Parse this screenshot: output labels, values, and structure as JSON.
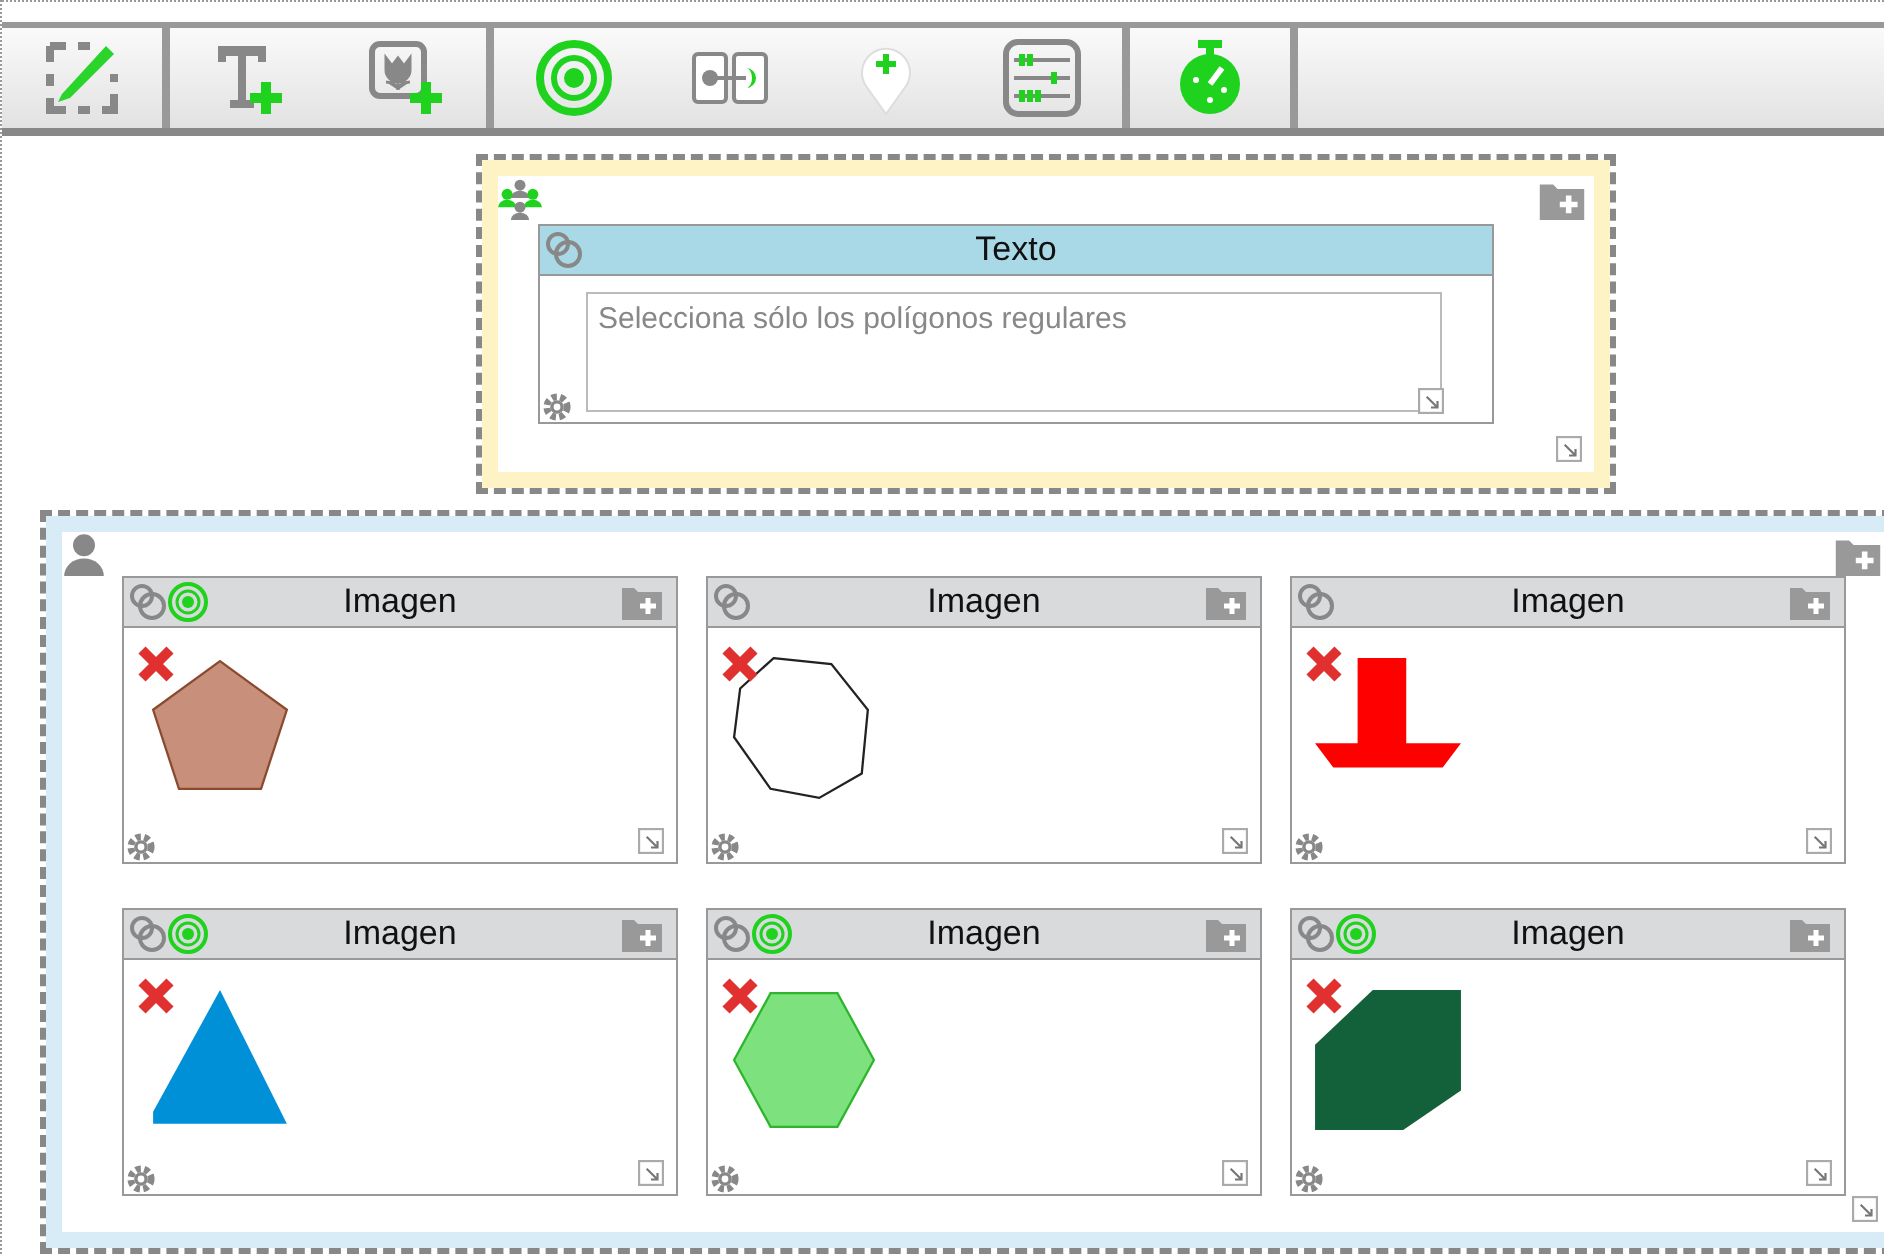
{
  "text_block": {
    "title": "Texto",
    "value": "Selecciona sólo los polígonos regulares"
  },
  "cards": [
    {
      "title": "Imagen",
      "correct": true,
      "kind": "pentagon",
      "color": "#c8907a"
    },
    {
      "title": "Imagen",
      "correct": false,
      "kind": "octagon",
      "color": "#222222"
    },
    {
      "title": "Imagen",
      "correct": false,
      "kind": "arrow",
      "color": "#ff0000"
    },
    {
      "title": "Imagen",
      "correct": true,
      "kind": "triangle",
      "color": "#0090d8"
    },
    {
      "title": "Imagen",
      "correct": true,
      "kind": "hexagon",
      "color": "#7de27d"
    },
    {
      "title": "Imagen",
      "correct": true,
      "kind": "parallelogram",
      "color": "#13613b"
    }
  ]
}
